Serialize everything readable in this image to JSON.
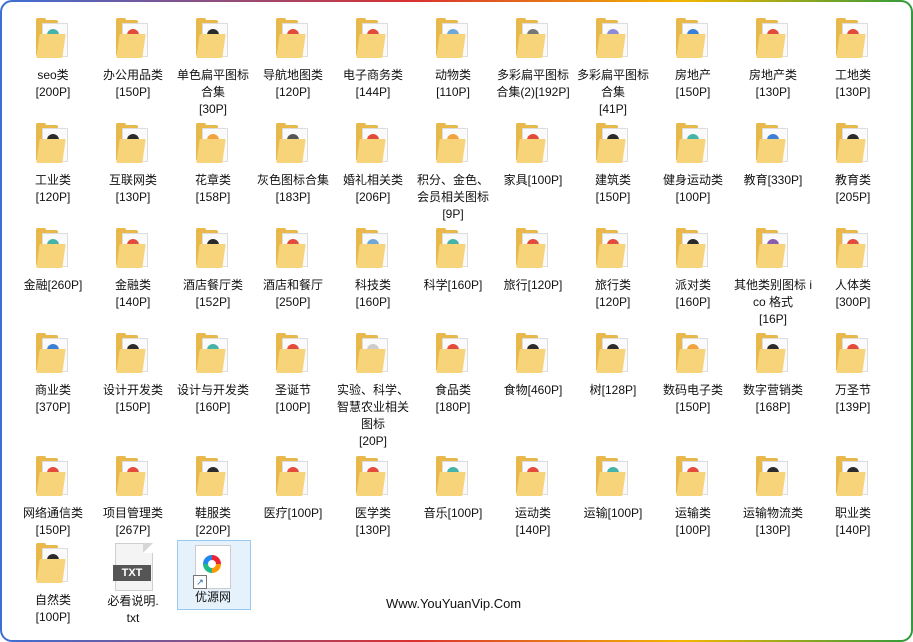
{
  "folders": [
    {
      "label": "seo类\n[200P]",
      "c1": "#45b3a8",
      "c2": "#e24a3b"
    },
    {
      "label": "办公用品类\n[150P]",
      "c1": "#e24a3b",
      "c2": "#2b2b2b"
    },
    {
      "label": "单色扁平图标合集\n[30P]",
      "c1": "#2b2b2b",
      "c2": "#777777"
    },
    {
      "label": "导航地图类\n[120P]",
      "c1": "#e24a3b",
      "c2": "#45b3a8"
    },
    {
      "label": "电子商务类\n[144P]",
      "c1": "#e24a3b",
      "c2": "#f1a340"
    },
    {
      "label": "动物类\n[110P]",
      "c1": "#6fa7d8",
      "c2": "#2b2b2b"
    },
    {
      "label": "多彩扁平图标合集(2)[192P]",
      "c1": "#777777",
      "c2": "#2b2b2b"
    },
    {
      "label": "多彩扁平图标合集\n[41P]",
      "c1": "#8b8bd8",
      "c2": "#cccccc"
    },
    {
      "label": "房地产\n[150P]",
      "c1": "#3b7fd6",
      "c2": "#2b2b2b"
    },
    {
      "label": "房地产类\n[130P]",
      "c1": "#e24a3b",
      "c2": "#f1a340"
    },
    {
      "label": "工地类\n[130P]",
      "c1": "#e24a3b",
      "c2": "#2b2b2b"
    },
    {
      "label": "工业类\n[120P]",
      "c1": "#2b2b2b",
      "c2": "#45b3a8"
    },
    {
      "label": "互联网类\n[130P]",
      "c1": "#2b2b2b",
      "c2": "#6fa7d8"
    },
    {
      "label": "花章类\n[158P]",
      "c1": "#f1a340",
      "c2": "#e24a3b"
    },
    {
      "label": "灰色图标合集[183P]",
      "c1": "#555555",
      "c2": "#999999"
    },
    {
      "label": "婚礼相关类\n[206P]",
      "c1": "#e24a3b",
      "c2": "#f1a340"
    },
    {
      "label": "积分、金色、会员相关图标[9P]",
      "c1": "#f1a340",
      "c2": "#d9a400"
    },
    {
      "label": "家具[100P]",
      "c1": "#e24a3b",
      "c2": "#2b2b2b"
    },
    {
      "label": "建筑类\n[150P]",
      "c1": "#2b2b2b",
      "c2": "#45b3a8"
    },
    {
      "label": "健身运动类\n[100P]",
      "c1": "#45b3a8",
      "c2": "#2b2b2b"
    },
    {
      "label": "教育[330P]",
      "c1": "#3b7fd6",
      "c2": "#2b2b2b"
    },
    {
      "label": "教育类\n[205P]",
      "c1": "#2b2b2b",
      "c2": "#e24a3b"
    },
    {
      "label": "金融[260P]",
      "c1": "#45b3a8",
      "c2": "#2b2b2b"
    },
    {
      "label": "金融类\n[140P]",
      "c1": "#e24a3b",
      "c2": "#2b2b2b"
    },
    {
      "label": "酒店餐厅类\n[152P]",
      "c1": "#2b2b2b",
      "c2": "#e24a3b"
    },
    {
      "label": "酒店和餐厅\n[250P]",
      "c1": "#e24a3b",
      "c2": "#f1a340"
    },
    {
      "label": "科技类\n[160P]",
      "c1": "#6fa7d8",
      "c2": "#e24a3b"
    },
    {
      "label": "科学[160P]",
      "c1": "#45b3a8",
      "c2": "#2b2b2b"
    },
    {
      "label": "旅行[120P]",
      "c1": "#e24a3b",
      "c2": "#45b3a8"
    },
    {
      "label": "旅行类\n[120P]",
      "c1": "#e24a3b",
      "c2": "#6fa7d8"
    },
    {
      "label": "派对类\n[160P]",
      "c1": "#2b2b2b",
      "c2": "#e24a3b"
    },
    {
      "label": "其他类别图标 ico 格式\n[16P]",
      "c1": "#8b5bb0",
      "c2": "#6fa7d8"
    },
    {
      "label": "人体类\n[300P]",
      "c1": "#e24a3b",
      "c2": "#2b2b2b"
    },
    {
      "label": "商业类\n[370P]",
      "c1": "#3b7fd6",
      "c2": "#f1a340"
    },
    {
      "label": "设计开发类\n[150P]",
      "c1": "#2b2b2b",
      "c2": "#f1a340"
    },
    {
      "label": "设计与开发类[160P]",
      "c1": "#45b3a8",
      "c2": "#e24a3b"
    },
    {
      "label": "圣诞节\n[100P]",
      "c1": "#e24a3b",
      "c2": "#45b3a8"
    },
    {
      "label": "实验、科学、智慧农业相关图标\n[20P]",
      "c1": "#cccccc",
      "c2": "#999999"
    },
    {
      "label": "食品类\n[180P]",
      "c1": "#e24a3b",
      "c2": "#2b2b2b"
    },
    {
      "label": "食物[460P]",
      "c1": "#2b2b2b",
      "c2": "#45b3a8"
    },
    {
      "label": "树[128P]",
      "c1": "#2b2b2b",
      "c2": "#e24a3b"
    },
    {
      "label": "数码电子类\n[150P]",
      "c1": "#f1a340",
      "c2": "#2b2b2b"
    },
    {
      "label": "数字营销类\n[168P]",
      "c1": "#2b2b2b",
      "c2": "#e24a3b"
    },
    {
      "label": "万圣节\n[139P]",
      "c1": "#e24a3b",
      "c2": "#45b3a8"
    },
    {
      "label": "网络通信类\n[150P]",
      "c1": "#e24a3b",
      "c2": "#6fa7d8"
    },
    {
      "label": "项目管理类\n[267P]",
      "c1": "#e24a3b",
      "c2": "#2b2b2b"
    },
    {
      "label": "鞋服类\n[220P]",
      "c1": "#2b2b2b",
      "c2": "#e24a3b"
    },
    {
      "label": "医疗[100P]",
      "c1": "#e24a3b",
      "c2": "#2b2b2b"
    },
    {
      "label": "医学类\n[130P]",
      "c1": "#e24a3b",
      "c2": "#f1a340"
    },
    {
      "label": "音乐[100P]",
      "c1": "#45b3a8",
      "c2": "#e24a3b"
    },
    {
      "label": "运动类\n[140P]",
      "c1": "#e24a3b",
      "c2": "#2b2b2b"
    },
    {
      "label": "运输[100P]",
      "c1": "#45b3a8",
      "c2": "#e24a3b"
    },
    {
      "label": "运输类\n[100P]",
      "c1": "#e24a3b",
      "c2": "#3b7fd6"
    },
    {
      "label": "运输物流类\n[130P]",
      "c1": "#2b2b2b",
      "c2": "#45b3a8"
    },
    {
      "label": "职业类\n[140P]",
      "c1": "#2b2b2b",
      "c2": "#e24a3b"
    },
    {
      "label": "自然类\n[100P]",
      "c1": "#2b2b2b",
      "c2": "#f1a340"
    }
  ],
  "txt_file": {
    "label": "必看说明.\ntxt",
    "badge": "TXT"
  },
  "shortcut": {
    "label": "优源网",
    "arrow": "↗"
  },
  "watermark": "Www.YouYuanVip.Com"
}
